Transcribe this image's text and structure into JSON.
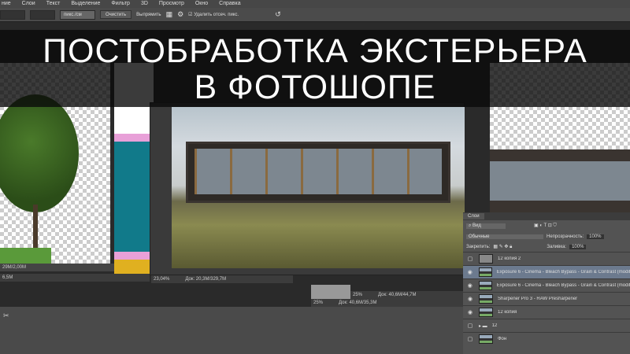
{
  "menu": [
    "ние",
    "Слои",
    "Текст",
    "Выделение",
    "Фильтр",
    "3D",
    "Просмотр",
    "Окно",
    "Справка"
  ],
  "options": {
    "units": "пикс./см",
    "clear": "Очистить",
    "straighten": "Выпрямить",
    "delete_cropped": "Удалить отсеч. пикс."
  },
  "title": {
    "line1": "ПОСТОБРАБОТКА ЭКСТЕРЬЕРА",
    "line2": "В ФОТОШОПЕ"
  },
  "docs": {
    "left_status1": "29M/2,00M",
    "left_status2": "6,5M",
    "center_zoom": "23,04%",
    "center_doc": "Док: 20,3M/329,7M",
    "mid_zoom": "25%",
    "mid_doc": "Док: 40,6M/44,7M",
    "low_zoom": "25%",
    "low_doc": "Док: 40,6M/35,3M"
  },
  "layers_panel": {
    "tab": "Слои",
    "filter": "Вид",
    "blend": "Обычные",
    "opacity_label": "Непрозрачность:",
    "opacity": "100%",
    "lock_label": "Закрепить:",
    "fill_label": "Заливка:",
    "fill": "100%",
    "layers": [
      {
        "name": "12 копия 2",
        "visible": false,
        "selected": false
      },
      {
        "name": "Exposure 6 - Cinema - Bleach Bypass - Grain & Contrast (modified",
        "visible": true,
        "selected": true
      },
      {
        "name": "Exposure 6 - Cinema - Bleach Bypass - Grain & Contrast (modified",
        "visible": true,
        "selected": false
      },
      {
        "name": "Sharpener Pro 3 - RAW Presharpener",
        "visible": true,
        "selected": false
      },
      {
        "name": "12 копия",
        "visible": true,
        "selected": false
      },
      {
        "name": "12",
        "visible": false,
        "selected": false,
        "group": true
      },
      {
        "name": "Фон",
        "visible": false,
        "selected": false
      }
    ]
  }
}
